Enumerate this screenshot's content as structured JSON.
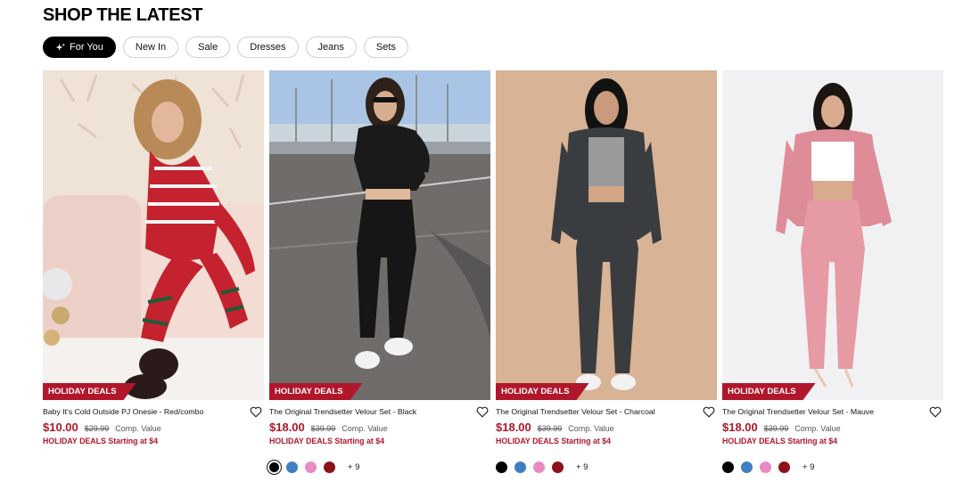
{
  "section": {
    "title": "SHOP THE LATEST"
  },
  "tabs": [
    {
      "label": "For You",
      "active": true,
      "icon": "sparkle-icon"
    },
    {
      "label": "New In",
      "active": false
    },
    {
      "label": "Sale",
      "active": false
    },
    {
      "label": "Dresses",
      "active": false
    },
    {
      "label": "Jeans",
      "active": false
    },
    {
      "label": "Sets",
      "active": false
    }
  ],
  "products": [
    {
      "tag": "HOLIDAY DEALS",
      "name": "Baby It's Cold Outside PJ Onesie - Red/combo",
      "price": "$10.00",
      "was": "$29.99",
      "comp": "Comp. Value",
      "promo": "HOLIDAY DEALS Starting at $4",
      "swatches": [],
      "more": ""
    },
    {
      "tag": "HOLIDAY DEALS",
      "name": "The Original Trendsetter Velour Set - Black",
      "price": "$18.00",
      "was": "$39.99",
      "comp": "Comp. Value",
      "promo": "HOLIDAY DEALS Starting at $4",
      "swatches": [
        "#000000",
        "#3e7fc1",
        "#e98ac3",
        "#8e1217"
      ],
      "selected_swatch": 0,
      "more": "+ 9"
    },
    {
      "tag": "HOLIDAY DEALS",
      "name": "The Original Trendsetter Velour Set - Charcoal",
      "price": "$18.00",
      "was": "$39.99",
      "comp": "Comp. Value",
      "promo": "HOLIDAY DEALS Starting at $4",
      "swatches": [
        "#000000",
        "#3e7fc1",
        "#e98ac3",
        "#8e1217"
      ],
      "selected_swatch": -1,
      "more": "+ 9"
    },
    {
      "tag": "HOLIDAY DEALS",
      "name": "The Original Trendsetter Velour Set - Mauve",
      "price": "$18.00",
      "was": "$39.99",
      "comp": "Comp. Value",
      "promo": "HOLIDAY DEALS Starting at $4",
      "swatches": [
        "#000000",
        "#3e7fc1",
        "#e98ac3",
        "#8e1217"
      ],
      "selected_swatch": -1,
      "more": "+ 9"
    }
  ],
  "colors": {
    "accent": "#b0172b",
    "tab_active_bg": "#000000"
  }
}
